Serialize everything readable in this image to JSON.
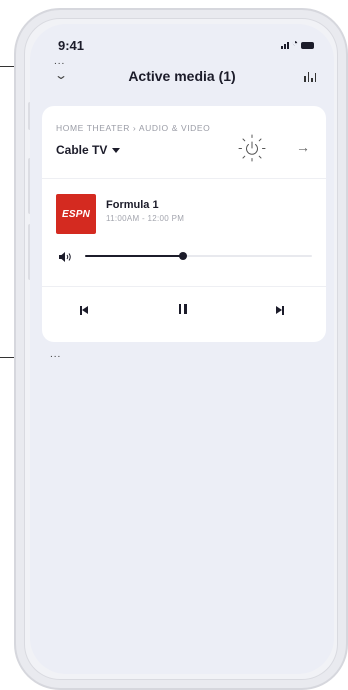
{
  "status_bar": {
    "time": "9:41"
  },
  "header": {
    "title": "Active media (1)"
  },
  "card": {
    "breadcrumb": "HOME THEATER  ›  AUDIO & VIDEO",
    "source_label": "Cable TV"
  },
  "now_playing": {
    "channel_logo_text": "ESPN",
    "title": "Formula 1",
    "time_range": "11:00AM - 12:00 PM",
    "volume": 0.43
  },
  "annotations": {
    "ellipsis": "..."
  },
  "colors": {
    "screen_bg": "#eceef6",
    "card_bg": "#ffffff",
    "accent_dark": "#1c1c2a",
    "brand_red": "#d42a20"
  },
  "icons": [
    "chevron-down-icon",
    "equalizer-icon",
    "power-icon",
    "arrow-right-icon",
    "volume-icon",
    "previous-icon",
    "pause-icon",
    "next-icon",
    "signal-icon",
    "wifi-icon",
    "battery-icon"
  ]
}
